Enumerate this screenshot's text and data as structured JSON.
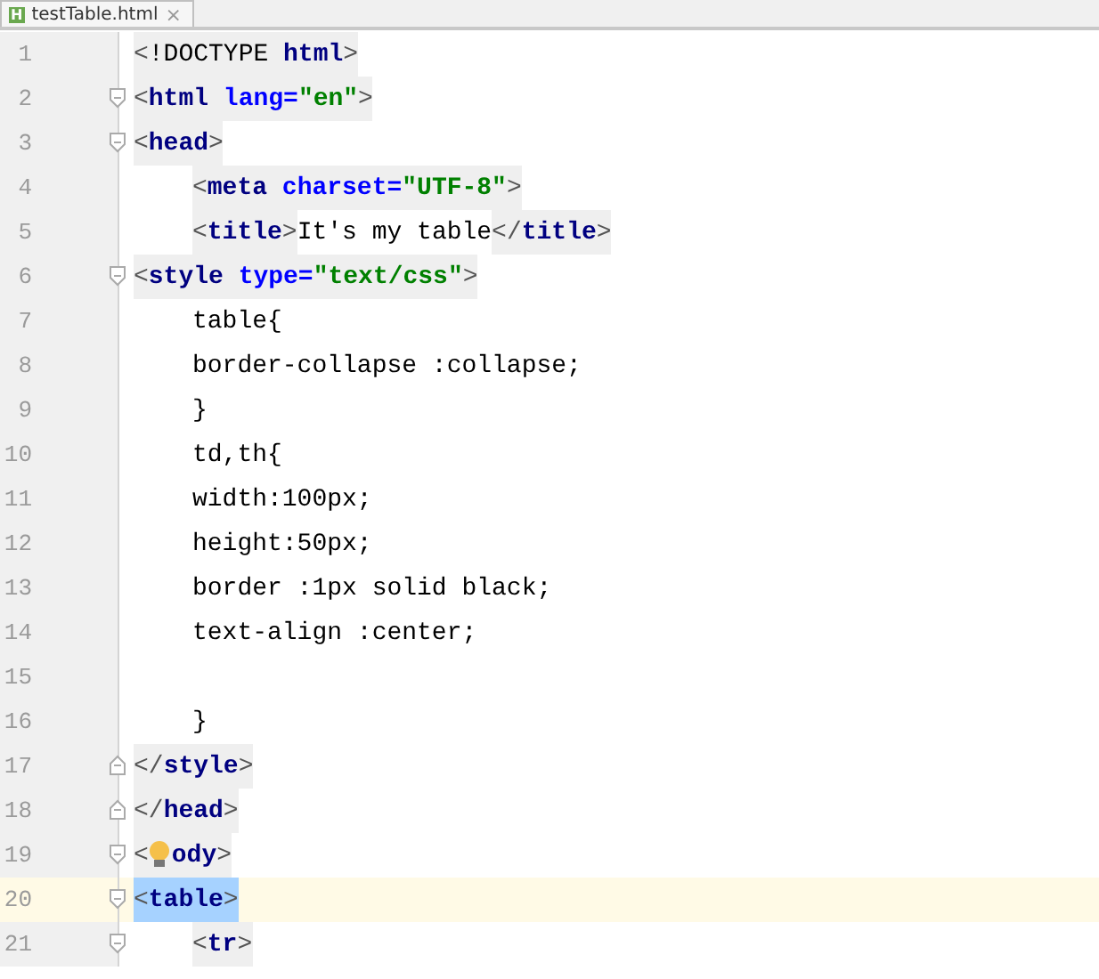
{
  "tab": {
    "icon_letter": "H",
    "title": "testTable.html",
    "close": "×"
  },
  "lines": [
    {
      "number": "1",
      "kind": "plain",
      "indented": false,
      "current": false,
      "segments": [
        {
          "kind": "tag",
          "selected": false,
          "tokens": [
            {
              "kind": "bracket",
              "text": "<"
            },
            {
              "kind": "plain",
              "text": "!DOCTYPE "
            },
            {
              "kind": "name",
              "text": "html"
            },
            {
              "kind": "bracket",
              "text": ">"
            }
          ]
        }
      ]
    },
    {
      "number": "2",
      "kind": "fold-start",
      "indented": false,
      "current": false,
      "segments": [
        {
          "kind": "tag",
          "selected": false,
          "tokens": [
            {
              "kind": "bracket",
              "text": "<"
            },
            {
              "kind": "name",
              "text": "html "
            },
            {
              "kind": "attr",
              "text": "lang="
            },
            {
              "kind": "value",
              "text": "\"en\""
            },
            {
              "kind": "bracket",
              "text": ">"
            }
          ]
        }
      ]
    },
    {
      "number": "3",
      "kind": "fold-start",
      "indented": false,
      "current": false,
      "segments": [
        {
          "kind": "tag",
          "selected": false,
          "tokens": [
            {
              "kind": "bracket",
              "text": "<"
            },
            {
              "kind": "name",
              "text": "head"
            },
            {
              "kind": "bracket",
              "text": ">"
            }
          ]
        }
      ]
    },
    {
      "number": "4",
      "kind": "plain",
      "indented": true,
      "current": false,
      "segments": [
        {
          "kind": "tag",
          "selected": false,
          "tokens": [
            {
              "kind": "bracket",
              "text": "<"
            },
            {
              "kind": "name",
              "text": "meta "
            },
            {
              "kind": "attr",
              "text": "charset="
            },
            {
              "kind": "value",
              "text": "\"UTF-8\""
            },
            {
              "kind": "bracket",
              "text": ">"
            }
          ]
        }
      ]
    },
    {
      "number": "5",
      "kind": "plain",
      "indented": true,
      "current": false,
      "segments": [
        {
          "kind": "tag",
          "selected": false,
          "tokens": [
            {
              "kind": "bracket",
              "text": "<"
            },
            {
              "kind": "name",
              "text": "title"
            },
            {
              "kind": "bracket",
              "text": ">"
            }
          ]
        },
        {
          "kind": "text",
          "selected": false,
          "tokens": [
            {
              "kind": "plain",
              "text": "It's my table"
            }
          ]
        },
        {
          "kind": "tag",
          "selected": false,
          "tokens": [
            {
              "kind": "bracket",
              "text": "</"
            },
            {
              "kind": "name",
              "text": "title"
            },
            {
              "kind": "bracket",
              "text": ">"
            }
          ]
        }
      ]
    },
    {
      "number": "6",
      "kind": "fold-start",
      "indented": false,
      "current": false,
      "segments": [
        {
          "kind": "tag",
          "selected": false,
          "tokens": [
            {
              "kind": "bracket",
              "text": "<"
            },
            {
              "kind": "name",
              "text": "style "
            },
            {
              "kind": "attr",
              "text": "type="
            },
            {
              "kind": "value",
              "text": "\"text/css\""
            },
            {
              "kind": "bracket",
              "text": ">"
            }
          ]
        }
      ]
    },
    {
      "number": "7",
      "kind": "plain",
      "indented": true,
      "current": false,
      "segments": [
        {
          "kind": "text",
          "selected": false,
          "tokens": [
            {
              "kind": "plain",
              "text": "table{"
            }
          ]
        }
      ]
    },
    {
      "number": "8",
      "kind": "plain",
      "indented": true,
      "current": false,
      "segments": [
        {
          "kind": "text",
          "selected": false,
          "tokens": [
            {
              "kind": "plain",
              "text": "border-collapse :collapse;"
            }
          ]
        }
      ]
    },
    {
      "number": "9",
      "kind": "plain",
      "indented": true,
      "current": false,
      "segments": [
        {
          "kind": "text",
          "selected": false,
          "tokens": [
            {
              "kind": "plain",
              "text": "}"
            }
          ]
        }
      ]
    },
    {
      "number": "10",
      "kind": "plain",
      "indented": true,
      "current": false,
      "segments": [
        {
          "kind": "text",
          "selected": false,
          "tokens": [
            {
              "kind": "plain",
              "text": "td,th{"
            }
          ]
        }
      ]
    },
    {
      "number": "11",
      "kind": "plain",
      "indented": true,
      "current": false,
      "segments": [
        {
          "kind": "text",
          "selected": false,
          "tokens": [
            {
              "kind": "plain",
              "text": "width:100px;"
            }
          ]
        }
      ]
    },
    {
      "number": "12",
      "kind": "plain",
      "indented": true,
      "current": false,
      "segments": [
        {
          "kind": "text",
          "selected": false,
          "tokens": [
            {
              "kind": "plain",
              "text": "height:50px;"
            }
          ]
        }
      ]
    },
    {
      "number": "13",
      "kind": "plain",
      "indented": true,
      "current": false,
      "segments": [
        {
          "kind": "text",
          "selected": false,
          "tokens": [
            {
              "kind": "plain",
              "text": "border :1px solid black;"
            }
          ]
        }
      ]
    },
    {
      "number": "14",
      "kind": "plain",
      "indented": true,
      "current": false,
      "segments": [
        {
          "kind": "text",
          "selected": false,
          "tokens": [
            {
              "kind": "plain",
              "text": "text-align :center;"
            }
          ]
        }
      ]
    },
    {
      "number": "15",
      "kind": "plain",
      "current": false
    },
    {
      "number": "16",
      "kind": "plain",
      "indented": true,
      "current": false,
      "segments": [
        {
          "kind": "text",
          "selected": false,
          "tokens": [
            {
              "kind": "plain",
              "text": "}"
            }
          ]
        }
      ]
    },
    {
      "number": "17",
      "kind": "fold-end",
      "indented": false,
      "current": false,
      "segments": [
        {
          "kind": "tag",
          "selected": false,
          "tokens": [
            {
              "kind": "bracket",
              "text": "</"
            },
            {
              "kind": "name",
              "text": "style"
            },
            {
              "kind": "bracket",
              "text": ">"
            }
          ]
        }
      ]
    },
    {
      "number": "18",
      "kind": "fold-end",
      "indented": false,
      "current": false,
      "segments": [
        {
          "kind": "tag",
          "selected": false,
          "tokens": [
            {
              "kind": "bracket",
              "text": "</"
            },
            {
              "kind": "name",
              "text": "head"
            },
            {
              "kind": "bracket",
              "text": ">"
            }
          ]
        }
      ]
    },
    {
      "number": "19",
      "kind": "fold-start",
      "indented": false,
      "current": false,
      "segments": [
        {
          "kind": "tag",
          "selected": false,
          "tokens": [
            {
              "kind": "bracket",
              "text": "<"
            },
            {
              "kind": "bulb"
            },
            {
              "kind": "name",
              "text": "ody"
            },
            {
              "kind": "bracket",
              "text": ">"
            }
          ]
        }
      ]
    },
    {
      "number": "20",
      "kind": "fold-start",
      "indented": false,
      "current": true,
      "segments": [
        {
          "kind": "tag",
          "selected": true,
          "tokens": [
            {
              "kind": "bracket",
              "text": "<"
            },
            {
              "kind": "name",
              "text": "table"
            },
            {
              "kind": "bracket",
              "text": ">"
            }
          ]
        }
      ]
    },
    {
      "number": "21",
      "kind": "fold-start",
      "indented": true,
      "current": false,
      "segments": [
        {
          "kind": "tag",
          "selected": false,
          "tokens": [
            {
              "kind": "bracket",
              "text": "<"
            },
            {
              "kind": "name",
              "text": "tr"
            },
            {
              "kind": "bracket",
              "text": ">"
            }
          ]
        }
      ]
    }
  ]
}
